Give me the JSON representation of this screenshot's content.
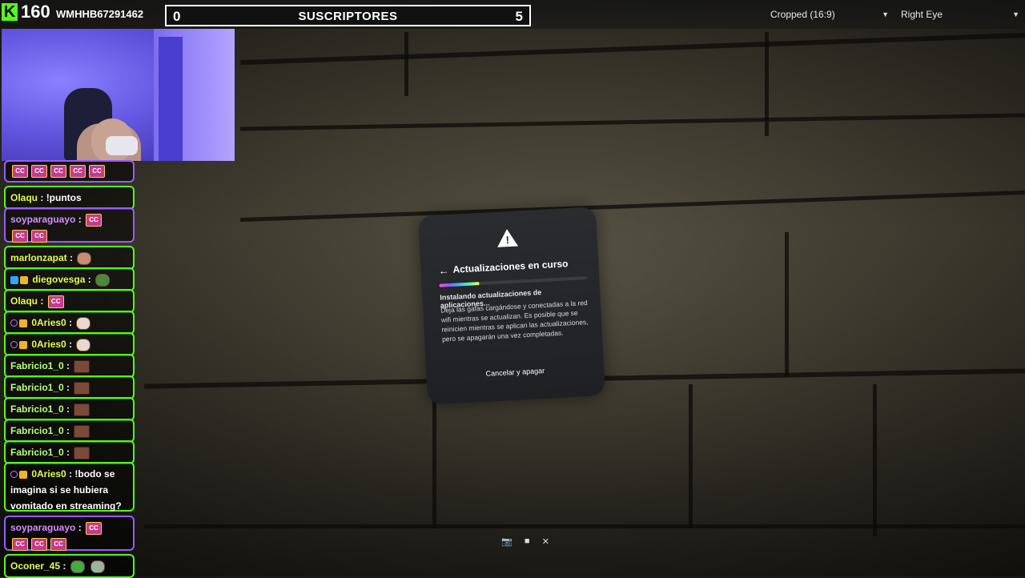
{
  "header": {
    "viewer_count": "160",
    "channel_code": "WMHHB67291462",
    "subs_left": "0",
    "subs_title": "SUSCRIPTORES",
    "subs_right": "5"
  },
  "view_controls": {
    "crop_select": "Cropped (16:9)",
    "eye_select": "Right Eye"
  },
  "chat": {
    "items": [
      {
        "user": "",
        "msg": "",
        "emotes": [
          "CC"
        ]
      },
      {
        "user": "Olaqu",
        "msg": ": !puntos"
      },
      {
        "user": "soyparaguayo",
        "msg": ":"
      },
      {
        "user": "marlonzapat",
        "msg": ":"
      },
      {
        "user": "diegovesga",
        "msg": ":"
      },
      {
        "user": "Olaqu",
        "msg": ":"
      },
      {
        "user": "0Aries0",
        "msg": ":"
      },
      {
        "user": "0Aries0",
        "msg": ":"
      },
      {
        "user": "Fabricio1_0",
        "msg": ":"
      },
      {
        "user": "Fabricio1_0",
        "msg": ":"
      },
      {
        "user": "Fabricio1_0",
        "msg": ":"
      },
      {
        "user": "Fabricio1_0",
        "msg": ":"
      },
      {
        "user": "Fabricio1_0",
        "msg": ":"
      },
      {
        "user": "0Aries0",
        "msg": ": !bodo se imagina si se hubiera vomitado en streaming?"
      },
      {
        "user": "soyparaguayo",
        "msg": ":"
      },
      {
        "user": "Oconer_45",
        "msg": ":"
      }
    ],
    "emote_cc": "CC"
  },
  "dialog": {
    "title": "Actualizaciones en curso",
    "status": "Instalando actualizaciones de aplicaciones...",
    "body": "Deja las gafas cargándose y conectadas a la red wifi mientras se actualizan. Es posible que se reinicien mientras se aplican las actualizaciones, pero se apagarán una vez completadas.",
    "cancel_label": "Cancelar y apagar",
    "progress": 0.27
  }
}
